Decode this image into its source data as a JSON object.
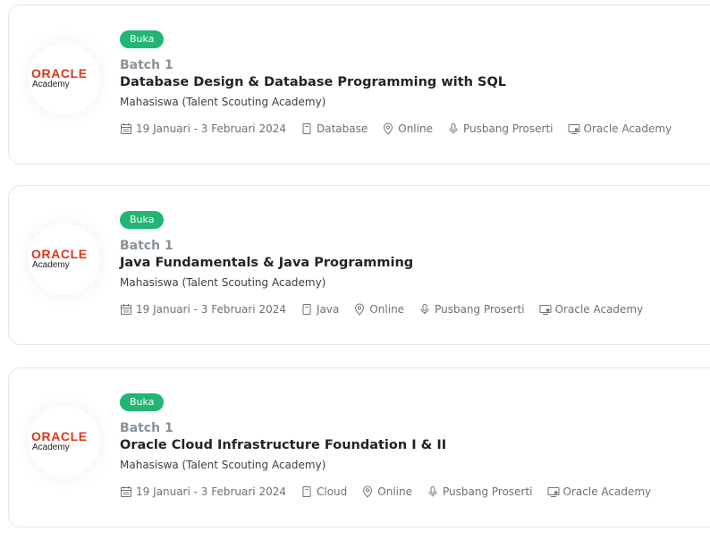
{
  "logo": {
    "brand": "ORACLE",
    "sub": "Academy"
  },
  "colors": {
    "badge": "#22b573",
    "brand_red": "#d9371f",
    "muted": "#8a939b"
  },
  "cards": [
    {
      "status": "Buka",
      "batch": "Batch 1",
      "title": "Database Design & Database Programming with SQL",
      "audience": "Mahasiswa (Talent Scouting Academy)",
      "date": "19 Januari - 3 Februari 2024",
      "category": "Database",
      "mode": "Online",
      "organizer": "Pusbang Proserti",
      "partner": "Oracle Academy"
    },
    {
      "status": "Buka",
      "batch": "Batch 1",
      "title": "Java Fundamentals & Java Programming",
      "audience": "Mahasiswa (Talent Scouting Academy)",
      "date": "19 Januari - 3 Februari 2024",
      "category": "Java",
      "mode": "Online",
      "organizer": "Pusbang Proserti",
      "partner": "Oracle Academy"
    },
    {
      "status": "Buka",
      "batch": "Batch 1",
      "title": "Oracle Cloud Infrastructure Foundation I & II",
      "audience": "Mahasiswa (Talent Scouting Academy)",
      "date": "19 Januari - 3 Februari 2024",
      "category": "Cloud",
      "mode": "Online",
      "organizer": "Pusbang Proserti",
      "partner": "Oracle Academy"
    }
  ],
  "icons": [
    "calendar-icon",
    "document-icon",
    "location-pin-icon",
    "microphone-icon",
    "monitor-icon"
  ]
}
